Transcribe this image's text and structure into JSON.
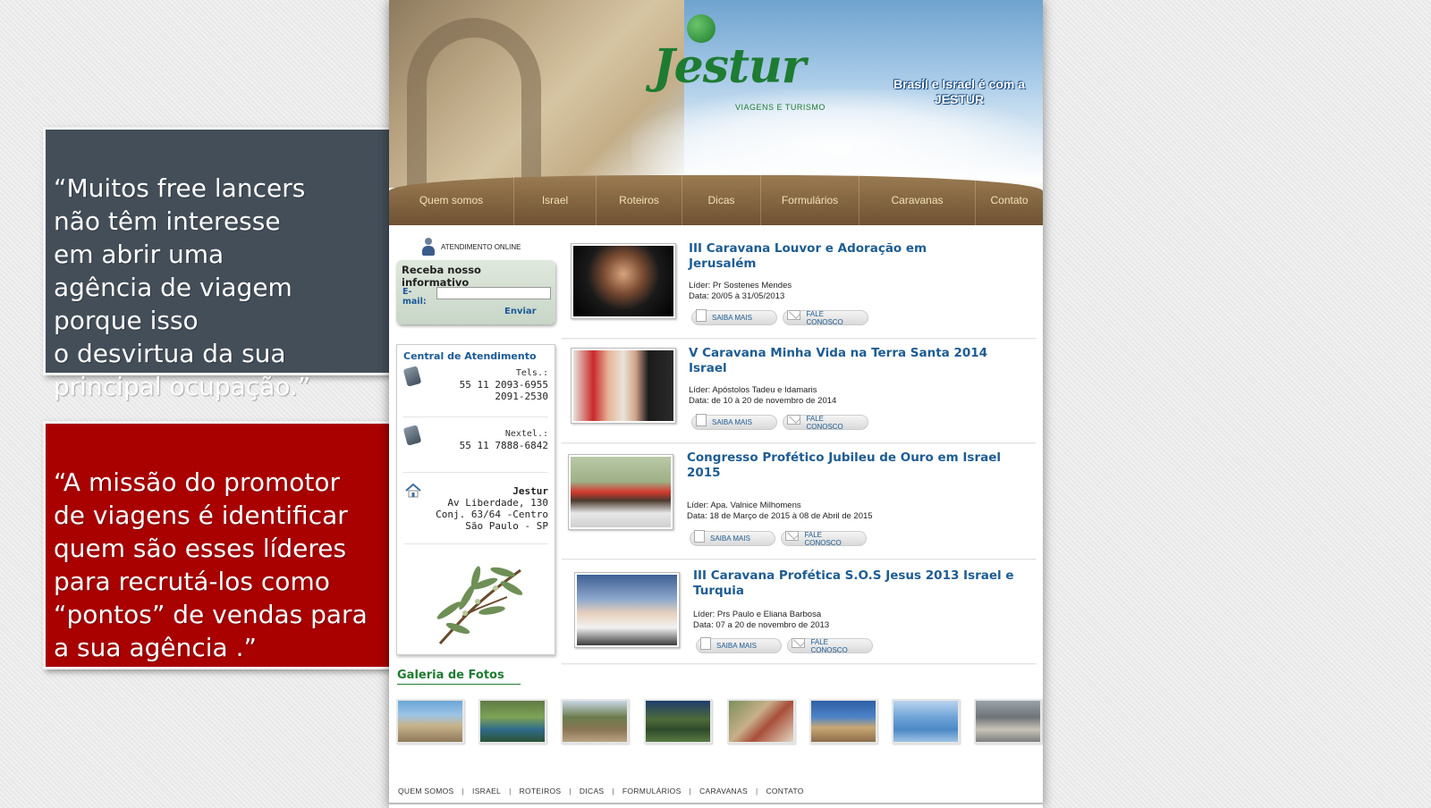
{
  "quotes": {
    "first": "“Muitos free lancers\nnão têm interesse\nem abrir uma\nagência de viagem\nporque isso\no desvirtua da sua\nprincipal ocupação.”",
    "second": "“A missão do promotor\nde viagens é identificar\nquem são esses líderes\npara recrutá-los como\n“pontos” de vendas para\na sua agência .”"
  },
  "header": {
    "brand": "Jestur",
    "brand_sub": "VIAGENS E TURISMO",
    "slogan_line1": "Brasil e Israel é com a",
    "slogan_line2": "JESTUR"
  },
  "nav": [
    "Quem somos",
    "Israel",
    "Roteiros",
    "Dicas",
    "Formulários",
    "Caravanas",
    "Contato"
  ],
  "sidebar": {
    "online_label": "ATENDIMENTO ONLINE",
    "newsletter_title": "Receba nosso informativo",
    "email_label": "E-mail:",
    "email_value": "",
    "send_label": "Enviar",
    "central_title": "Central de Atendimento",
    "tel_label": "Tels.:",
    "tel_1": "55 11 2093-6955",
    "tel_2": "2091-2530",
    "nextel_label": "Nextel.:",
    "nextel": "55 11 7888-6842",
    "address_name": "Jestur",
    "address_1": "Av Liberdade, 130",
    "address_2": "Conj. 63/64 -Centro",
    "address_3": "São Paulo - SP"
  },
  "trips": [
    {
      "title": "III Caravana Louvor e Adoração em Jerusalém",
      "leader": "Líder: Pr Sostenes Mendes",
      "date": "Data: 20/05 à 31/05/2013"
    },
    {
      "title": "V Caravana Minha Vida na Terra Santa 2014 Israel",
      "leader": "Líder: Apóstolos Tadeu e Idamaris",
      "date": "Data: de 10 à 20 de novembro de 2014"
    },
    {
      "title": "Congresso Profético Jubileu de Ouro em Israel 2015",
      "leader": "Líder: Apa. Valnice Milhomens",
      "date": "Data: 18 de Março de 2015 à 08 de Abril de 2015"
    },
    {
      "title": "III Caravana Profética S.O.S Jesus 2013 Israel e Turquia",
      "leader": "Líder: Prs Paulo e Eliana Barbosa",
      "date": "Data: 07 a 20 de novembro de 2013"
    }
  ],
  "buttons": {
    "saiba": "SAIBA MAIS",
    "fale": "FALE CONOSCO"
  },
  "gallery": {
    "title": "Galeria de Fotos"
  },
  "footer": [
    "QUEM SOMOS",
    "ISRAEL",
    "ROTEIROS",
    "DICAS",
    "FORMULÁRIOS",
    "CARAVANAS",
    "CONTATO"
  ],
  "colors": {
    "quote_grey": "#434e59",
    "quote_red": "#a90000",
    "link_blue": "#1d5c93",
    "brand_green": "#1e7b32",
    "nav_brown": "#7a5c3a"
  }
}
